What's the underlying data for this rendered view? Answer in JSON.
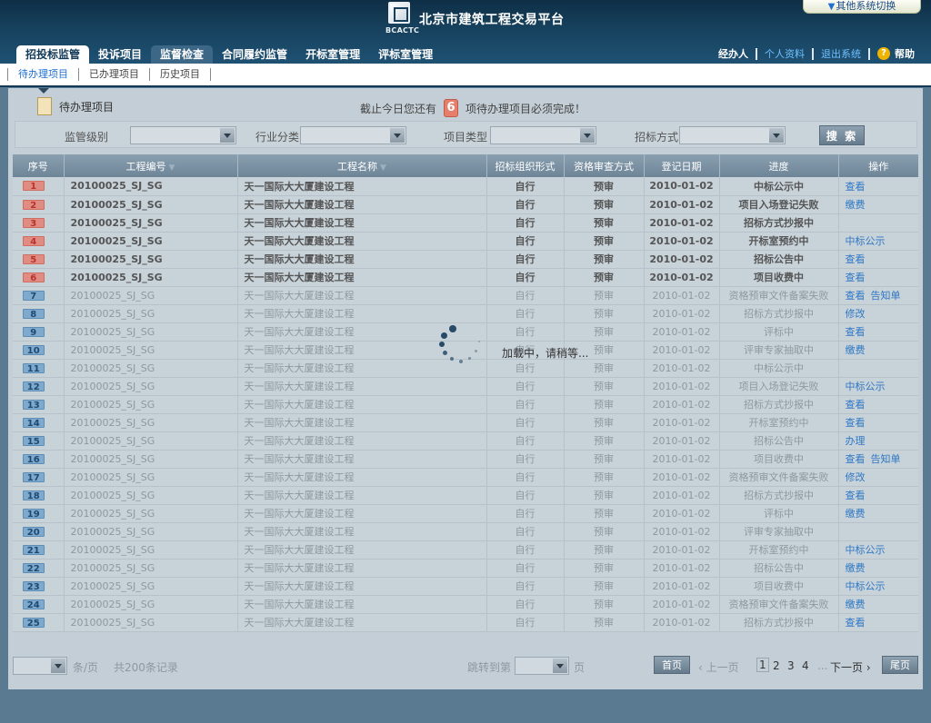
{
  "header": {
    "logo_text": "BCACTC",
    "site_title": "北京市建筑工程交易平台",
    "switch_label": "其他系统切换",
    "nav": [
      "招投标监管",
      "投诉项目",
      "监督检查",
      "合同履约监管",
      "开标室管理",
      "评标室管理"
    ],
    "user": {
      "role": "经办人",
      "profile": "个人资料",
      "logout": "退出系统",
      "help": "帮助"
    }
  },
  "subnav": [
    "待办理项目",
    "已办理项目",
    "历史项目"
  ],
  "todo": {
    "title": "待办理项目",
    "notice_before": "截止今日您还有",
    "count": "6",
    "notice_after": "项待办理项目必须完成！"
  },
  "filters": {
    "level_label": "监管级别",
    "industry_label": "行业分类",
    "type_label": "项目类型",
    "method_label": "招标方式",
    "search": "搜 索"
  },
  "table": {
    "headers": [
      "序号",
      "工程编号",
      "工程名称",
      "招标组织形式",
      "资格审查方式",
      "登记日期",
      "进度",
      "操作"
    ],
    "rows": [
      {
        "no": "1",
        "code": "20100025_SJ_SG",
        "name": "天一国际大大厦建设工程",
        "org": "自行",
        "qual": "预审",
        "date": "2010-01-02",
        "progress": "中标公示中",
        "ops": [
          "查看"
        ]
      },
      {
        "no": "2",
        "code": "20100025_SJ_SG",
        "name": "天一国际大大厦建设工程",
        "org": "自行",
        "qual": "预审",
        "date": "2010-01-02",
        "progress": "项目入场登记失败",
        "ops": [
          "缴费"
        ]
      },
      {
        "no": "3",
        "code": "20100025_SJ_SG",
        "name": "天一国际大大厦建设工程",
        "org": "自行",
        "qual": "预审",
        "date": "2010-01-02",
        "progress": "招标方式抄报中",
        "ops": []
      },
      {
        "no": "4",
        "code": "20100025_SJ_SG",
        "name": "天一国际大大厦建设工程",
        "org": "自行",
        "qual": "预审",
        "date": "2010-01-02",
        "progress": "开标室预约中",
        "ops": [
          "中标公示"
        ]
      },
      {
        "no": "5",
        "code": "20100025_SJ_SG",
        "name": "天一国际大大厦建设工程",
        "org": "自行",
        "qual": "预审",
        "date": "2010-01-02",
        "progress": "招标公告中",
        "ops": [
          "查看"
        ]
      },
      {
        "no": "6",
        "code": "20100025_SJ_SG",
        "name": "天一国际大大厦建设工程",
        "org": "自行",
        "qual": "预审",
        "date": "2010-01-02",
        "progress": "项目收费中",
        "ops": [
          "查看"
        ]
      },
      {
        "no": "7",
        "code": "20100025_SJ_SG",
        "name": "天一国际大大厦建设工程",
        "org": "自行",
        "qual": "预审",
        "date": "2010-01-02",
        "progress": "资格预审文件备案失败",
        "ops": [
          "查看",
          "告知单"
        ]
      },
      {
        "no": "8",
        "code": "20100025_SJ_SG",
        "name": "天一国际大大厦建设工程",
        "org": "自行",
        "qual": "预审",
        "date": "2010-01-02",
        "progress": "招标方式抄报中",
        "ops": [
          "修改"
        ]
      },
      {
        "no": "9",
        "code": "20100025_SJ_SG",
        "name": "天一国际大大厦建设工程",
        "org": "自行",
        "qual": "预审",
        "date": "2010-01-02",
        "progress": "评标中",
        "ops": [
          "查看"
        ]
      },
      {
        "no": "10",
        "code": "20100025_SJ_SG",
        "name": "天一国际大大厦建设工程",
        "org": "自行",
        "qual": "预审",
        "date": "2010-01-02",
        "progress": "评审专家抽取中",
        "ops": [
          "缴费"
        ]
      },
      {
        "no": "11",
        "code": "20100025_SJ_SG",
        "name": "天一国际大大厦建设工程",
        "org": "自行",
        "qual": "预审",
        "date": "2010-01-02",
        "progress": "中标公示中",
        "ops": []
      },
      {
        "no": "12",
        "code": "20100025_SJ_SG",
        "name": "天一国际大大厦建设工程",
        "org": "自行",
        "qual": "预审",
        "date": "2010-01-02",
        "progress": "项目入场登记失败",
        "ops": [
          "中标公示"
        ]
      },
      {
        "no": "13",
        "code": "20100025_SJ_SG",
        "name": "天一国际大大厦建设工程",
        "org": "自行",
        "qual": "预审",
        "date": "2010-01-02",
        "progress": "招标方式抄报中",
        "ops": [
          "查看"
        ]
      },
      {
        "no": "14",
        "code": "20100025_SJ_SG",
        "name": "天一国际大大厦建设工程",
        "org": "自行",
        "qual": "预审",
        "date": "2010-01-02",
        "progress": "开标室预约中",
        "ops": [
          "查看"
        ]
      },
      {
        "no": "15",
        "code": "20100025_SJ_SG",
        "name": "天一国际大大厦建设工程",
        "org": "自行",
        "qual": "预审",
        "date": "2010-01-02",
        "progress": "招标公告中",
        "ops": [
          "办理"
        ]
      },
      {
        "no": "16",
        "code": "20100025_SJ_SG",
        "name": "天一国际大大厦建设工程",
        "org": "自行",
        "qual": "预审",
        "date": "2010-01-02",
        "progress": "项目收费中",
        "ops": [
          "查看",
          "告知单"
        ]
      },
      {
        "no": "17",
        "code": "20100025_SJ_SG",
        "name": "天一国际大大厦建设工程",
        "org": "自行",
        "qual": "预审",
        "date": "2010-01-02",
        "progress": "资格预审文件备案失败",
        "ops": [
          "修改"
        ]
      },
      {
        "no": "18",
        "code": "20100025_SJ_SG",
        "name": "天一国际大大厦建设工程",
        "org": "自行",
        "qual": "预审",
        "date": "2010-01-02",
        "progress": "招标方式抄报中",
        "ops": [
          "查看"
        ]
      },
      {
        "no": "19",
        "code": "20100025_SJ_SG",
        "name": "天一国际大大厦建设工程",
        "org": "自行",
        "qual": "预审",
        "date": "2010-01-02",
        "progress": "评标中",
        "ops": [
          "缴费"
        ]
      },
      {
        "no": "20",
        "code": "20100025_SJ_SG",
        "name": "天一国际大大厦建设工程",
        "org": "自行",
        "qual": "预审",
        "date": "2010-01-02",
        "progress": "评审专家抽取中",
        "ops": []
      },
      {
        "no": "21",
        "code": "20100025_SJ_SG",
        "name": "天一国际大大厦建设工程",
        "org": "自行",
        "qual": "预审",
        "date": "2010-01-02",
        "progress": "开标室预约中",
        "ops": [
          "中标公示"
        ]
      },
      {
        "no": "22",
        "code": "20100025_SJ_SG",
        "name": "天一国际大大厦建设工程",
        "org": "自行",
        "qual": "预审",
        "date": "2010-01-02",
        "progress": "招标公告中",
        "ops": [
          "缴费"
        ]
      },
      {
        "no": "23",
        "code": "20100025_SJ_SG",
        "name": "天一国际大大厦建设工程",
        "org": "自行",
        "qual": "预审",
        "date": "2010-01-02",
        "progress": "项目收费中",
        "ops": [
          "中标公示"
        ]
      },
      {
        "no": "24",
        "code": "20100025_SJ_SG",
        "name": "天一国际大大厦建设工程",
        "org": "自行",
        "qual": "预审",
        "date": "2010-01-02",
        "progress": "资格预审文件备案失败",
        "ops": [
          "缴费"
        ]
      },
      {
        "no": "25",
        "code": "20100025_SJ_SG",
        "name": "天一国际大大厦建设工程",
        "org": "自行",
        "qual": "预审",
        "date": "2010-01-02",
        "progress": "招标方式抄报中",
        "ops": [
          "查看"
        ]
      }
    ]
  },
  "loading_text": "加载中，请稍等...",
  "pager": {
    "per_page_unit": "条/页",
    "total": "共200条记录",
    "jump_to": "跳转到第",
    "page_unit": "页",
    "first": "首页",
    "prev": "上一页",
    "pages": [
      "1",
      "2",
      "3",
      "4"
    ],
    "ellipsis": "...",
    "next": "下一页",
    "last": "尾页"
  }
}
